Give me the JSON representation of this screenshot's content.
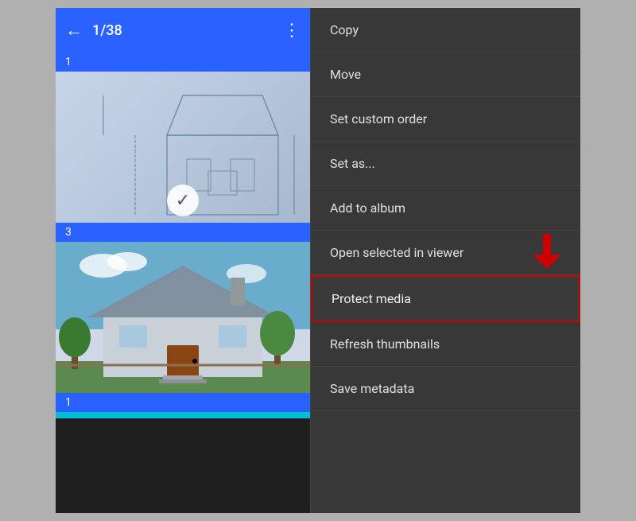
{
  "header": {
    "back_label": "←",
    "title": "1/38",
    "menu_label": "⋮"
  },
  "file_items": [
    {
      "number": "1"
    },
    {
      "number": "3"
    },
    {
      "number": "1"
    }
  ],
  "context_menu": {
    "items": [
      {
        "id": "copy",
        "label": "Copy",
        "highlighted": false
      },
      {
        "id": "move",
        "label": "Move",
        "highlighted": false
      },
      {
        "id": "set-custom-order",
        "label": "Set custom order",
        "highlighted": false
      },
      {
        "id": "set-as",
        "label": "Set as...",
        "highlighted": false
      },
      {
        "id": "add-to-album",
        "label": "Add to album",
        "highlighted": false
      },
      {
        "id": "open-selected-in-viewer",
        "label": "Open selected in viewer",
        "highlighted": false
      },
      {
        "id": "protect-media",
        "label": "Protect media",
        "highlighted": true
      },
      {
        "id": "refresh-thumbnails",
        "label": "Refresh thumbnails",
        "highlighted": false
      },
      {
        "id": "save-metadata",
        "label": "Save metadata",
        "highlighted": false
      }
    ]
  },
  "colors": {
    "accent_blue": "#2962ff",
    "menu_bg": "#383838",
    "highlight_border": "#cc0000",
    "text_primary": "#e0e0e0"
  }
}
